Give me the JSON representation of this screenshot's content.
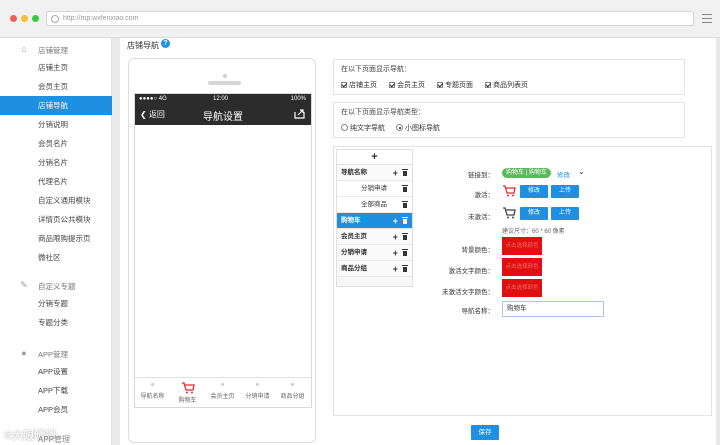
{
  "browser": {
    "url": "http://mp.wxfenxiao.com"
  },
  "sidebar": {
    "groups": [
      {
        "label": "店铺管理",
        "icon": "home-icon",
        "items": [
          "店铺主页",
          "会员主页",
          "店铺导航",
          "分销说明",
          "会员名片",
          "分销名片",
          "代理名片",
          "自定义通用模块",
          "详情页公共模块",
          "商品限购提示页",
          "微社区"
        ]
      },
      {
        "label": "自定义专题",
        "icon": "pencil-icon",
        "items": [
          "分销专题",
          "专题分类"
        ]
      },
      {
        "label": "APP管理",
        "icon": "apple-icon",
        "items": [
          "APP设置",
          "APP下载",
          "APP会员"
        ]
      }
    ],
    "active_item": "店铺导航",
    "partial_item": "APP管理"
  },
  "main": {
    "title": "店铺导航",
    "phone": {
      "status": {
        "signal": "●●●●○ 4G",
        "time": "12:00",
        "battery": "100%"
      },
      "nav_title": "导航设置",
      "back_label": "返回",
      "tabs": [
        "导航名称",
        "购物车",
        "会员主页",
        "分销申请",
        "商品分组"
      ]
    },
    "show_pages": {
      "label": "在以下页面显示导航：",
      "options": [
        {
          "label": "店铺主页",
          "checked": true
        },
        {
          "label": "会员主页",
          "checked": true
        },
        {
          "label": "专题页面",
          "checked": true
        },
        {
          "label": "商品列表页",
          "checked": true
        }
      ]
    },
    "nav_type": {
      "label": "在以下页面显示导航类型：",
      "options": [
        {
          "label": "纯文字导航",
          "checked": false
        },
        {
          "label": "小图标导航",
          "checked": true
        }
      ]
    },
    "nav_list": {
      "add_label": "+",
      "rows": [
        {
          "label": "导航名称",
          "kind": "parent"
        },
        {
          "label": "分销申请",
          "kind": "child"
        },
        {
          "label": "全部商品",
          "kind": "child"
        },
        {
          "label": "购物车",
          "kind": "parent",
          "active": true
        },
        {
          "label": "会员主页",
          "kind": "parent"
        },
        {
          "label": "分销申请",
          "kind": "parent"
        },
        {
          "label": "商品分组",
          "kind": "parent"
        }
      ]
    },
    "form": {
      "link_label": "链接到：",
      "link_value": "购物车 | 购物车",
      "link_edit": "修改",
      "active_label": "激活：",
      "inactive_label": "未激活：",
      "edit_btn": "修改",
      "upload_btn": "上传",
      "size_hint": "建议尺寸：60 * 60 像素",
      "bg_color_label": "背景颜色：",
      "active_text_color_label": "激活文字颜色：",
      "inactive_text_color_label": "未激活文字颜色：",
      "swatch_text": "点击选择颜色",
      "name_label": "导航名称：",
      "name_value": "购物车"
    },
    "save_label": "保存"
  },
  "colors": {
    "accent": "#1e8fe1",
    "swatch": "#e01010",
    "link_pill": "#5cb85c",
    "cart_icon": "#e02a2a"
  },
  "watermark": {
    "text": "©大眼晴週",
    "sub": "APP管理"
  }
}
